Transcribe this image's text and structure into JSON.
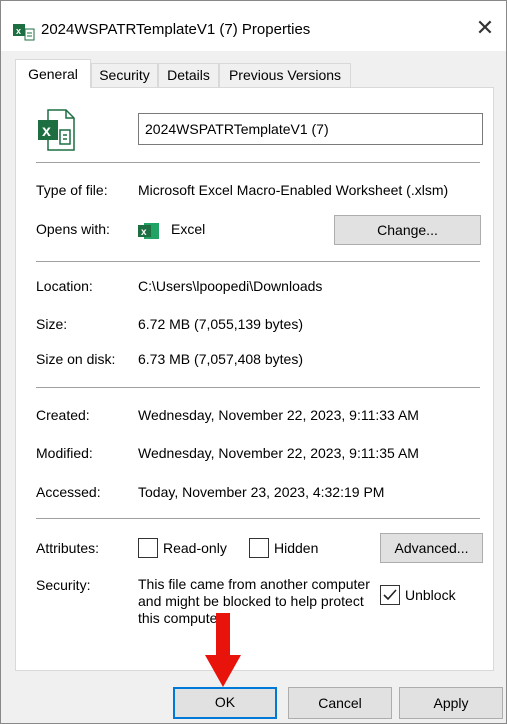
{
  "window": {
    "title": "2024WSPATRTemplateV1 (7) Properties",
    "close_glyph": "✕"
  },
  "tabs": [
    {
      "label": "General"
    },
    {
      "label": "Security"
    },
    {
      "label": "Details"
    },
    {
      "label": "Previous Versions"
    }
  ],
  "file": {
    "name": "2024WSPATRTemplateV1 (7)",
    "type_label": "Type of file:",
    "type_value": "Microsoft Excel Macro-Enabled Worksheet (.xlsm)",
    "opens_label": "Opens with:",
    "opens_value": "Excel",
    "change_label": "Change..."
  },
  "location": {
    "location_label": "Location:",
    "location_value": "C:\\Users\\lpoopedi\\Downloads",
    "size_label": "Size:",
    "size_value": "6.72 MB (7,055,139 bytes)",
    "disk_label": "Size on disk:",
    "disk_value": "6.73 MB (7,057,408 bytes)"
  },
  "dates": {
    "created_label": "Created:",
    "created_value": "Wednesday, November 22, 2023, 9:11:33 AM",
    "modified_label": "Modified:",
    "modified_value": "Wednesday, November 22, 2023, 9:11:35 AM",
    "accessed_label": "Accessed:",
    "accessed_value": "Today, November 23, 2023, 4:32:19 PM"
  },
  "attributes": {
    "label": "Attributes:",
    "readonly_label": "Read-only",
    "readonly_checked": false,
    "hidden_label": "Hidden",
    "hidden_checked": false,
    "advanced_label": "Advanced..."
  },
  "security": {
    "label": "Security:",
    "text": "This file came from another computer and might be blocked to help protect this computer.",
    "unblock_label": "Unblock",
    "unblock_checked": true
  },
  "footer": {
    "ok_label": "OK",
    "cancel_label": "Cancel",
    "apply_label": "Apply"
  },
  "colors": {
    "excel_green": "#1d6f42",
    "focus_blue": "#0078d7",
    "arrow_red": "#e8140c"
  },
  "icons": {
    "file_icon": "excel-file-icon",
    "app_icon": "excel-app-icon",
    "arrow": "red-down-arrow-icon"
  }
}
